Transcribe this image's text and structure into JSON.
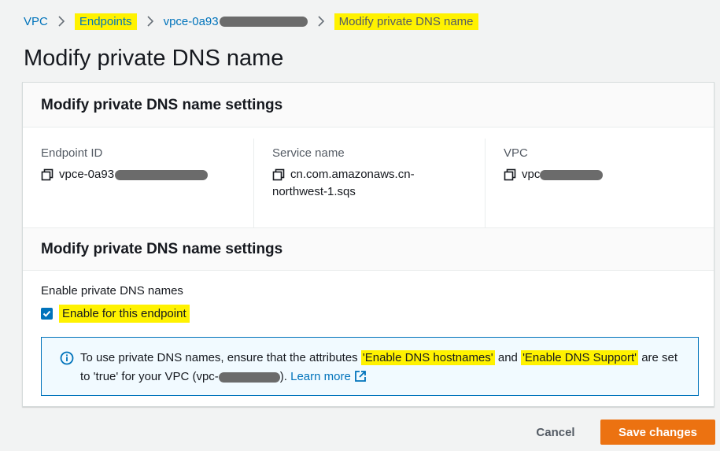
{
  "breadcrumb": {
    "items": [
      "VPC",
      "Endpoints",
      "vpce-0a93",
      "Modify private DNS name"
    ]
  },
  "page": {
    "title": "Modify private DNS name"
  },
  "details": {
    "header": "Modify private DNS name settings",
    "endpoint_id_label": "Endpoint ID",
    "endpoint_id_value": "vpce-0a93",
    "service_name_label": "Service name",
    "service_name_line1": "cn.com.amazonaws.cn-",
    "service_name_line2": "northwest-1.sqs",
    "vpc_label": "VPC",
    "vpc_value": "vpc"
  },
  "settings": {
    "header": "Modify private DNS name settings",
    "field_label": "Enable private DNS names",
    "checkbox_label": "Enable for this endpoint",
    "checkbox_checked": true
  },
  "info": {
    "text_1": "To use private DNS names, ensure that the attributes ",
    "attr_1": "'Enable DNS hostnames'",
    "text_2": " and ",
    "attr_2": "'Enable DNS Support'",
    "text_3": " are set to 'true' for your VPC (vpc-",
    "text_4": "). ",
    "learn_more": "Learn more"
  },
  "actions": {
    "cancel": "Cancel",
    "save": "Save changes"
  },
  "colors": {
    "primary": "#ec7211",
    "link": "#0073bb",
    "highlight": "#fff200"
  }
}
